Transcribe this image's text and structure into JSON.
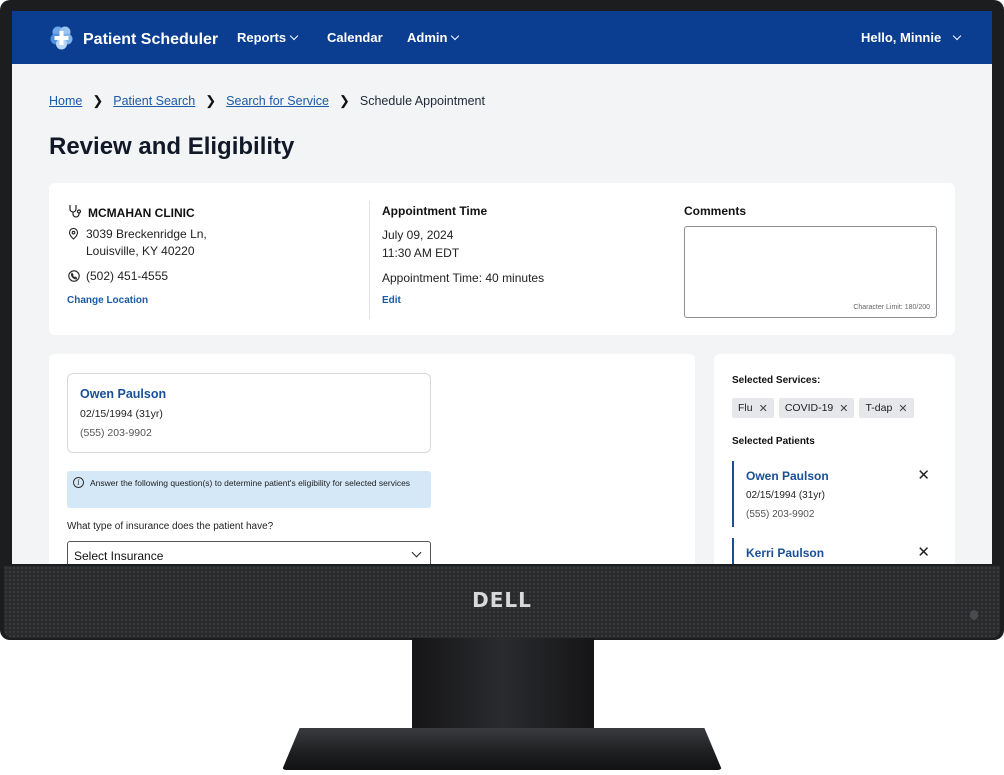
{
  "app": {
    "brand": "Patient Scheduler",
    "nav": [
      {
        "label": "Reports"
      },
      {
        "label": "Calendar"
      },
      {
        "label": "Admin"
      }
    ],
    "user_greeting": "Hello, Minnie",
    "accent_color": "#0b3d91"
  },
  "breadcrumb": {
    "home": "Home",
    "patient_search": "Patient Search",
    "search_for_service": "Search for Service",
    "current": "Schedule Appointment"
  },
  "page_title": "Review and Eligibility",
  "location": {
    "clinic_name": "MCMAHAN CLINIC",
    "address_line1": "3039 Breckenridge Ln,",
    "address_line2": "Louisville, KY 40220",
    "phone": "(502) 451-4555",
    "change_link": "Change Location"
  },
  "appointment": {
    "heading": "Appointment Time",
    "date": "July 09, 2024",
    "time": "11:30 AM EDT",
    "duration": "Appointment Time: 40 minutes",
    "edit_link": "Edit"
  },
  "comments": {
    "heading": "Comments",
    "value": "",
    "char_limit": "Character Limit: 180/200"
  },
  "current_patient": {
    "name": "Owen Paulson",
    "dob": "02/15/1994 (31yr)",
    "phone": "(555) 203-9902"
  },
  "eligibility": {
    "info_text": "Answer the following question(s) to determine patient's eligibility for selected services",
    "question": "What type of insurance does the patient have?",
    "select_value": "Select Insurance"
  },
  "sidebar": {
    "services_heading": "Selected Services:",
    "services": [
      {
        "label": "Flu"
      },
      {
        "label": "COVID-19"
      },
      {
        "label": "T-dap"
      }
    ],
    "patients_heading": "Selected Patients",
    "patients": [
      {
        "name": "Owen Paulson",
        "dob": "02/15/1994 (31yr)",
        "phone": "(555) 203-9902"
      },
      {
        "name": "Kerri Paulson",
        "dob": "",
        "phone": ""
      }
    ]
  },
  "monitor": {
    "brand": "DELL"
  }
}
